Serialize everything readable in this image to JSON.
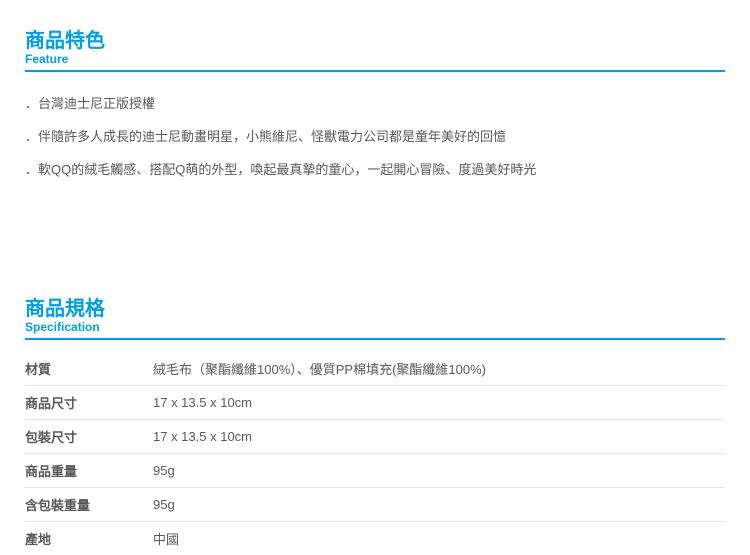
{
  "feature": {
    "title_cn": "商品特色",
    "title_en": "Feature",
    "items": [
      "．台灣迪士尼正版授權",
      "．伴隨許多人成長的迪士尼動畫明星，小熊維尼、怪獸電力公司都是童年美好的回憶",
      "．軟QQ的絨毛觸感、搭配Q萌的外型，喚起最真摯的童心，一起開心冒險、度過美好時光"
    ]
  },
  "spec": {
    "title_cn": "商品規格",
    "title_en": "Specification",
    "rows": [
      {
        "label": "材質",
        "value": "絨毛布（聚酯纖維100%）、優質PP棉填充(聚酯纖維100%)"
      },
      {
        "label": "商品尺寸",
        "value": "17 x 13.5 x 10cm"
      },
      {
        "label": "包裝尺寸",
        "value": "17 x 13.5 x 10cm"
      },
      {
        "label": "商品重量",
        "value": "95g"
      },
      {
        "label": "含包裝重量",
        "value": "95g"
      },
      {
        "label": "產地",
        "value": "中國"
      }
    ]
  }
}
